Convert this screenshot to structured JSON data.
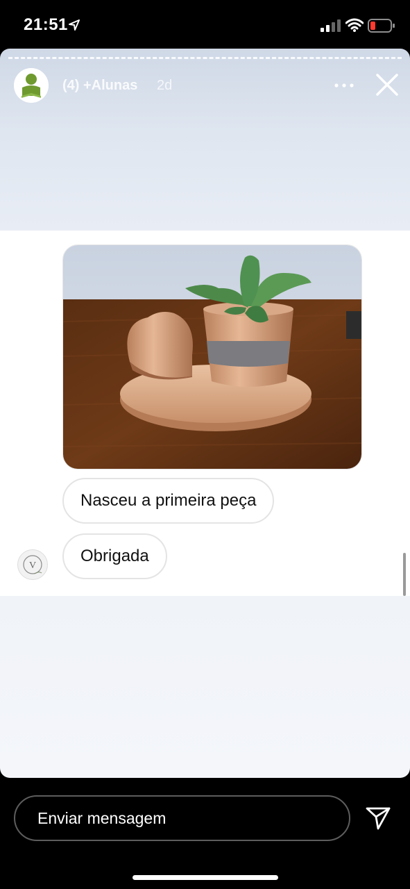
{
  "status_bar": {
    "time": "21:51",
    "icons": [
      "location-arrow-icon",
      "cellular-signal-icon",
      "wifi-icon",
      "battery-low-icon"
    ]
  },
  "story": {
    "account_name": "(4) +Alunas",
    "age": "2d",
    "icons": [
      "more-icon",
      "close-icon"
    ]
  },
  "shared_chat": {
    "photo": "photo of a copper-painted succulent pot and heart on a concrete tray",
    "messages": [
      {
        "text": "Nasceu a primeira peça"
      },
      {
        "text": "Obrigada"
      }
    ],
    "sender_avatar": "V"
  },
  "reply": {
    "placeholder": "Enviar mensagem",
    "send_icon": "send-paper-plane-icon"
  },
  "colors": {
    "background": "#000000",
    "story_top": "#cfd8e6",
    "bubble_border": "#e4e4e4",
    "battery_low": "#ff3b30"
  }
}
